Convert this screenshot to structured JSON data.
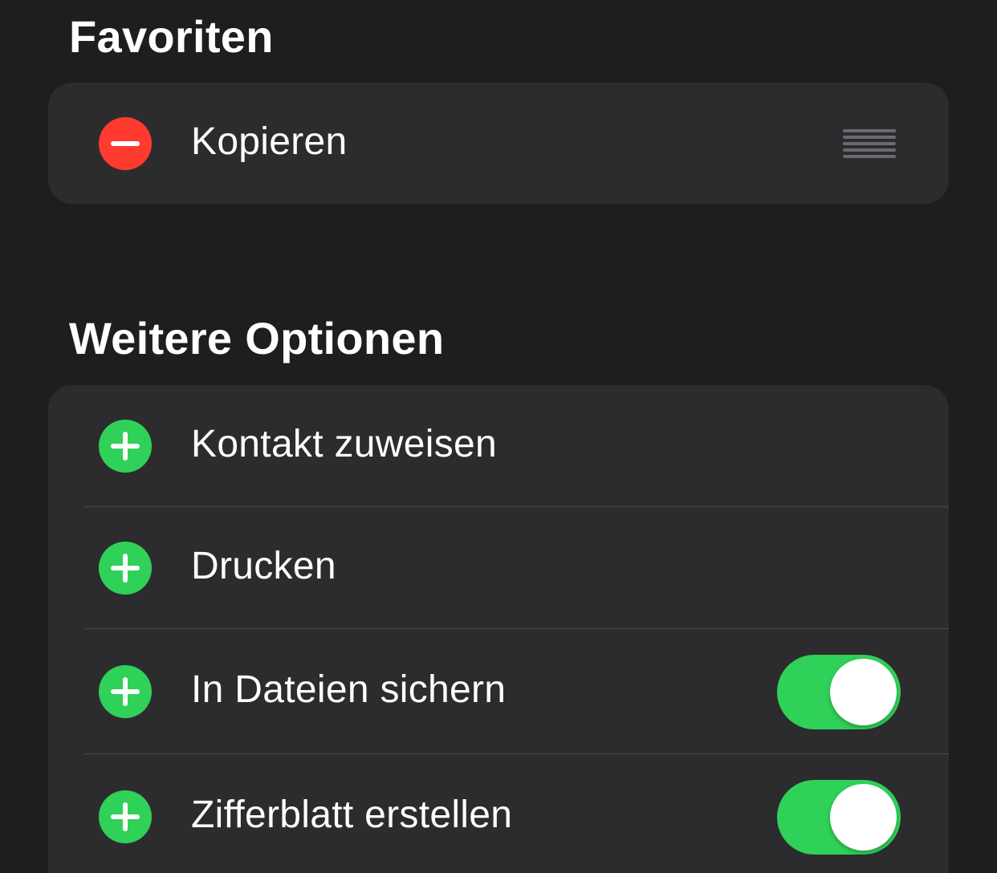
{
  "favorites": {
    "title": "Favoriten",
    "items": [
      {
        "label": "Kopieren",
        "action": "remove",
        "icon": "minus-icon",
        "reorderable": true
      }
    ]
  },
  "more_options": {
    "title": "Weitere Optionen",
    "items": [
      {
        "label": "Kontakt zuweisen",
        "action": "add",
        "icon": "plus-icon",
        "toggle": null
      },
      {
        "label": "Drucken",
        "action": "add",
        "icon": "plus-icon",
        "toggle": null
      },
      {
        "label": "In Dateien sichern",
        "action": "add",
        "icon": "plus-icon",
        "toggle": true
      },
      {
        "label": "Zifferblatt erstellen",
        "action": "add",
        "icon": "plus-icon",
        "toggle": true
      }
    ]
  },
  "colors": {
    "background": "#1e1e1f",
    "card": "#2c2c2e",
    "remove": "#ff3b30",
    "add": "#30d158",
    "toggle_on": "#30d158",
    "text": "#ffffff"
  }
}
